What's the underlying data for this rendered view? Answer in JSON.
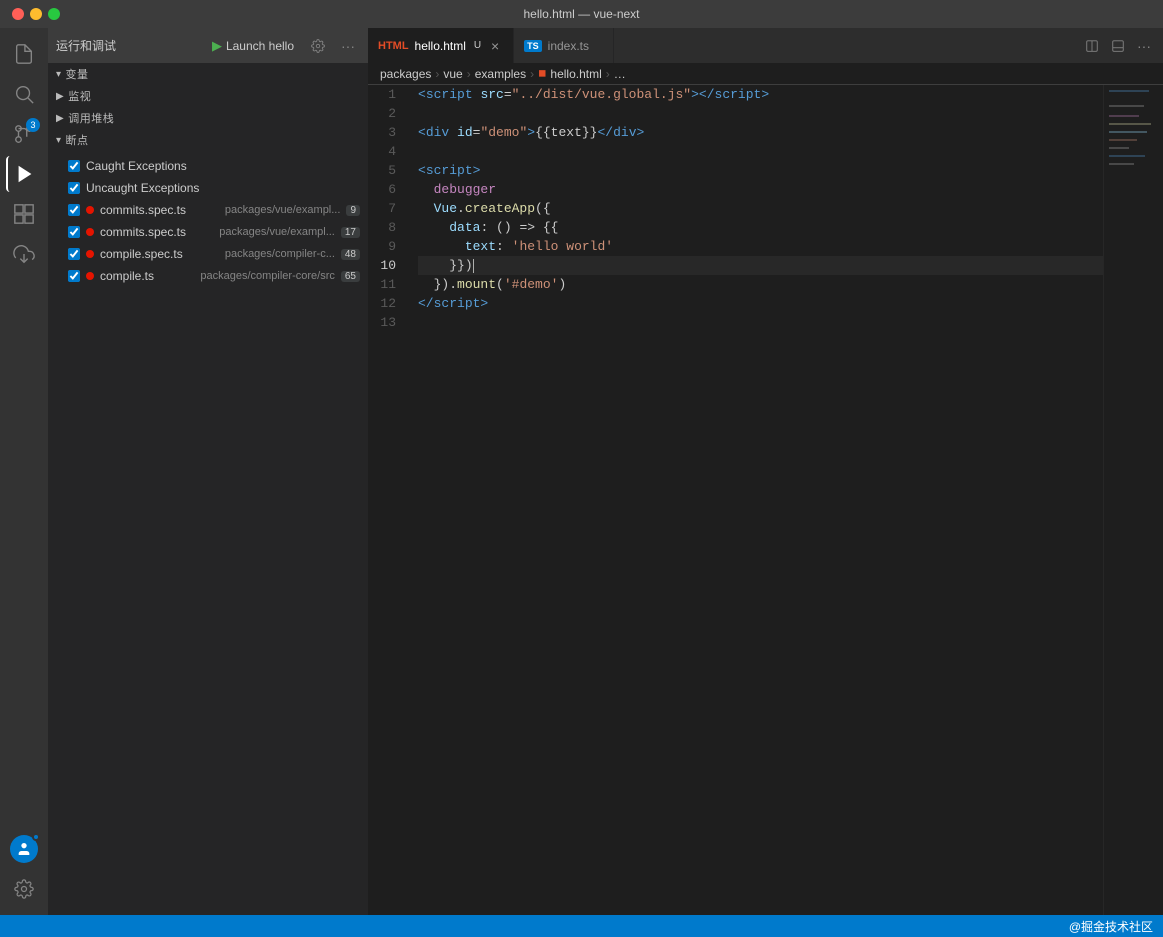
{
  "titlebar": {
    "title": "hello.html — vue-next"
  },
  "activity": {
    "items": [
      {
        "name": "files-icon",
        "icon": "⎘",
        "label": "Explorer"
      },
      {
        "name": "search-icon",
        "icon": "🔍",
        "label": "Search"
      },
      {
        "name": "source-control-icon",
        "icon": "⑂",
        "label": "Source Control",
        "badge": "3"
      },
      {
        "name": "run-icon",
        "icon": "▷",
        "label": "Run",
        "active": true
      },
      {
        "name": "extensions-icon",
        "icon": "⊞",
        "label": "Extensions"
      },
      {
        "name": "remote-icon",
        "icon": "↓",
        "label": "Remote"
      }
    ],
    "bottom": [
      {
        "name": "account-icon",
        "icon": "👤",
        "badge": true
      },
      {
        "name": "settings-icon",
        "icon": "⚙"
      }
    ]
  },
  "debug": {
    "title": "运行和调试",
    "run_label": "Launch hello",
    "sections": {
      "variables": "变量",
      "watch": "监视",
      "call_stack": "调用堆栈",
      "breakpoints": "断点"
    },
    "breakpoints": [
      {
        "checked": true,
        "has_dot": false,
        "filename": "Caught Exceptions",
        "path": ""
      },
      {
        "checked": true,
        "has_dot": false,
        "filename": "Uncaught Exceptions",
        "path": ""
      },
      {
        "checked": true,
        "has_dot": true,
        "filename": "commits.spec.ts",
        "path": "packages/vue/exampl...",
        "count": "9"
      },
      {
        "checked": true,
        "has_dot": true,
        "filename": "commits.spec.ts",
        "path": "packages/vue/exampl...",
        "count": "17"
      },
      {
        "checked": true,
        "has_dot": true,
        "filename": "compile.spec.ts",
        "path": "packages/compiler-c...",
        "count": "48"
      },
      {
        "checked": true,
        "has_dot": true,
        "filename": "compile.ts",
        "path": "packages/compiler-core/src",
        "count": "65"
      }
    ]
  },
  "tabs": [
    {
      "name": "hello.html",
      "icon_type": "html",
      "active": true,
      "modified": false,
      "label": "hello.html"
    },
    {
      "name": "index.ts",
      "icon_type": "ts",
      "active": false,
      "modified": false,
      "label": "index.ts"
    }
  ],
  "breadcrumb": {
    "items": [
      "packages",
      "vue",
      "examples",
      "hello.html",
      "…"
    ]
  },
  "code": {
    "lines": [
      {
        "num": 1,
        "tokens": [
          {
            "t": "<",
            "c": "c-tag"
          },
          {
            "t": "script",
            "c": "c-tag"
          },
          {
            "t": " ",
            "c": "c-text"
          },
          {
            "t": "src",
            "c": "c-attr"
          },
          {
            "t": "=",
            "c": "c-text"
          },
          {
            "t": "\"../dist/vue.global.js\"",
            "c": "c-string"
          },
          {
            "t": ">",
            "c": "c-tag"
          },
          {
            "t": "</",
            "c": "c-tag"
          },
          {
            "t": "script",
            "c": "c-tag"
          },
          {
            "t": ">",
            "c": "c-tag"
          }
        ]
      },
      {
        "num": 2,
        "tokens": []
      },
      {
        "num": 3,
        "tokens": [
          {
            "t": "<",
            "c": "c-tag"
          },
          {
            "t": "div",
            "c": "c-tag"
          },
          {
            "t": " ",
            "c": "c-text"
          },
          {
            "t": "id",
            "c": "c-attr"
          },
          {
            "t": "=",
            "c": "c-text"
          },
          {
            "t": "\"demo\"",
            "c": "c-string"
          },
          {
            "t": ">",
            "c": "c-tag"
          },
          {
            "t": "{{text}}",
            "c": "c-text"
          },
          {
            "t": "</",
            "c": "c-tag"
          },
          {
            "t": "div",
            "c": "c-tag"
          },
          {
            "t": ">",
            "c": "c-tag"
          }
        ]
      },
      {
        "num": 4,
        "tokens": []
      },
      {
        "num": 5,
        "tokens": [
          {
            "t": "<",
            "c": "c-tag"
          },
          {
            "t": "script",
            "c": "c-tag"
          },
          {
            "t": ">",
            "c": "c-tag"
          }
        ]
      },
      {
        "num": 6,
        "tokens": [
          {
            "t": "  debugger",
            "c": "c-keyword"
          }
        ]
      },
      {
        "num": 7,
        "tokens": [
          {
            "t": "  ",
            "c": "c-text"
          },
          {
            "t": "Vue",
            "c": "c-var"
          },
          {
            "t": ".",
            "c": "c-punct"
          },
          {
            "t": "createApp",
            "c": "c-func"
          },
          {
            "t": "({",
            "c": "c-punct"
          }
        ]
      },
      {
        "num": 8,
        "tokens": [
          {
            "t": "    ",
            "c": "c-text"
          },
          {
            "t": "data",
            "c": "c-prop"
          },
          {
            "t": ": () => {",
            "c": "c-punct"
          }
        ]
      },
      {
        "num": 9,
        "tokens": [
          {
            "t": "      ",
            "c": "c-text"
          },
          {
            "t": "text",
            "c": "c-prop"
          },
          {
            "t": ": ",
            "c": "c-punct"
          },
          {
            "t": "'hello world'",
            "c": "c-string"
          }
        ]
      },
      {
        "num": 10,
        "tokens": [
          {
            "t": "    }",
            "c": "c-text"
          },
          {
            "t": "}",
            "c": "c-text"
          },
          {
            "t": ")",
            "c": "c-punct"
          }
        ],
        "cursor": true
      },
      {
        "num": 11,
        "tokens": [
          {
            "t": "  ",
            "c": "c-text"
          },
          {
            "t": "}",
            "c": "c-punct"
          },
          {
            "t": ").",
            "c": "c-punct"
          },
          {
            "t": "mount",
            "c": "c-func"
          },
          {
            "t": "(",
            "c": "c-punct"
          },
          {
            "t": "'#demo'",
            "c": "c-string"
          },
          {
            "t": ")",
            "c": "c-punct"
          }
        ]
      },
      {
        "num": 12,
        "tokens": [
          {
            "t": "</",
            "c": "c-tag"
          },
          {
            "t": "script",
            "c": "c-tag"
          },
          {
            "t": ">",
            "c": "c-tag"
          }
        ]
      },
      {
        "num": 13,
        "tokens": []
      }
    ]
  },
  "statusbar": {
    "right_text": "@掘金技术社区"
  }
}
